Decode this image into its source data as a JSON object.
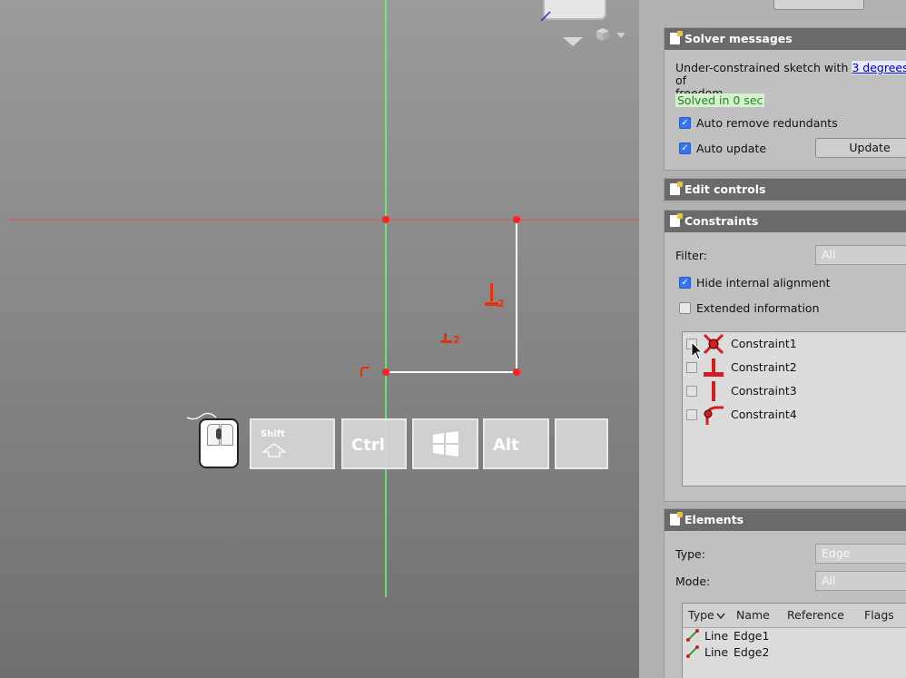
{
  "viewport": {
    "axes_colors": {
      "x_axis": "#e05050",
      "y_axis": "#66ff66"
    },
    "sketch_colors": {
      "point": "#ff2020",
      "line": "#ffffff",
      "constraint": "#e8300c"
    },
    "constraint_labels": {
      "vertical": "2",
      "horizontal": "2"
    },
    "nav_cube_icon": "navigation-cube-icon",
    "keys": {
      "shift": "Shift",
      "ctrl": "Ctrl",
      "alt": "Alt"
    }
  },
  "panel": {
    "solver": {
      "title": "Solver messages",
      "message_prefix": "Under-constrained sketch with",
      "link_text": "3 degrees",
      "message_suffix": "of",
      "message_line2": "freedom.",
      "status": "Solved in 0 sec",
      "auto_remove_label": "Auto remove redundants",
      "auto_update_label": "Auto update",
      "update_button": "Update"
    },
    "edit_controls": {
      "title": "Edit controls"
    },
    "constraints": {
      "title": "Constraints",
      "filter_label": "Filter:",
      "filter_value": "All",
      "hide_internal_label": "Hide internal alignment",
      "extended_info_label": "Extended information",
      "items": [
        {
          "label": "Constraint1",
          "icon": "coincident-icon"
        },
        {
          "label": "Constraint2",
          "icon": "horizontal-constraint-icon"
        },
        {
          "label": "Constraint3",
          "icon": "vertical-constraint-icon"
        },
        {
          "label": "Constraint4",
          "icon": "point-on-object-icon"
        }
      ]
    },
    "elements": {
      "title": "Elements",
      "type_label": "Type:",
      "type_value": "Edge",
      "mode_label": "Mode:",
      "mode_value": "All",
      "columns": [
        "Type",
        "Name",
        "Reference",
        "Flags"
      ],
      "rows": [
        {
          "type": "Line",
          "name": "Edge1"
        },
        {
          "type": "Line",
          "name": "Edge2"
        }
      ]
    }
  }
}
